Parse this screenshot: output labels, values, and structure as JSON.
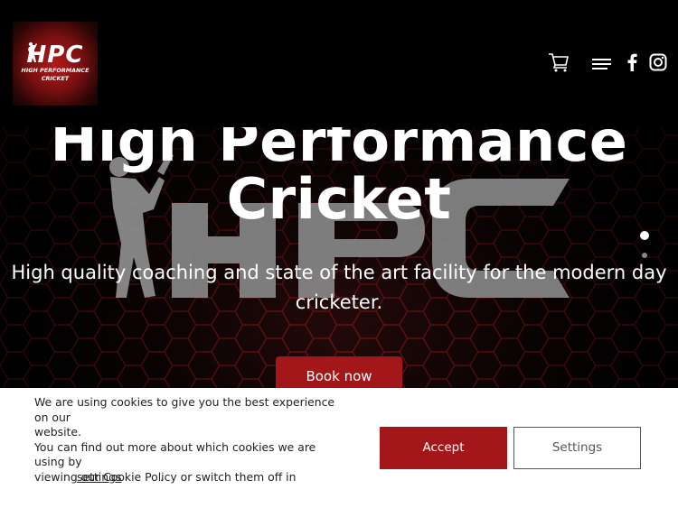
{
  "header": {
    "logo": {
      "mark": "HPC",
      "line1": "HIGH PERFORMANCE",
      "line2": "CRICKET"
    },
    "icons": [
      "cart-icon",
      "menu-icon",
      "facebook-icon",
      "instagram-icon"
    ]
  },
  "hero": {
    "title_line1": "High Performance",
    "title_line2": "Cricket",
    "subtitle": "High quality coaching and state of the art facility for the modern day cricketer.",
    "cta_label": "Book now",
    "slider_dots": 2,
    "active_slide": 1
  },
  "cookie_banner": {
    "text_line1": "We are using cookies to give you the best experience on our",
    "text_line2": "website.",
    "text_line3": "You can find out more about which cookies we are using by",
    "text_line4": "viewing our Cookie Policy or switch them off in",
    "settings_link": "settings",
    "period": ".",
    "accept_label": "Accept",
    "settings_label": "Settings"
  },
  "colors": {
    "accent": "#a3171b",
    "header_bg": "#000000",
    "banner_bg": "#ffffff"
  }
}
